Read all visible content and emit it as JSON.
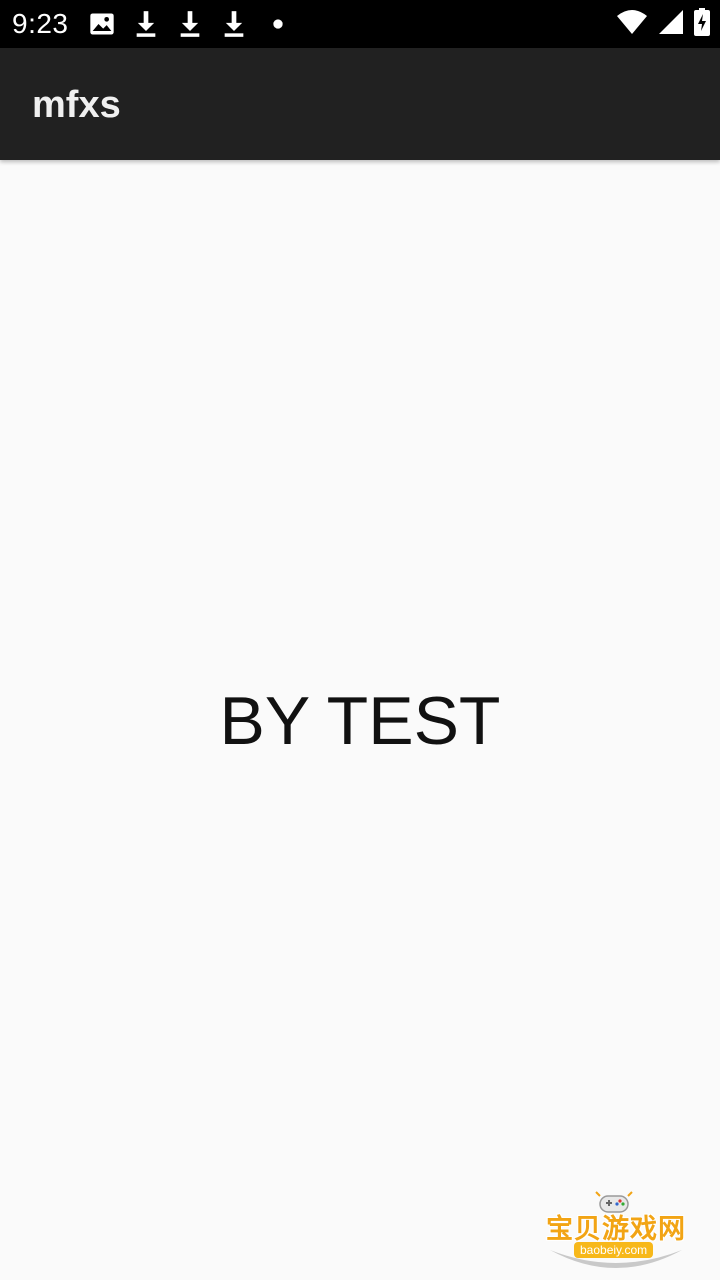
{
  "status_bar": {
    "time": "9:23",
    "icons_left": [
      "image-icon",
      "download-icon",
      "download-icon",
      "download-icon",
      "dot-icon"
    ],
    "icons_right": [
      "wifi-icon",
      "signal-icon",
      "battery-charging-icon"
    ]
  },
  "app_bar": {
    "title": "mfxs"
  },
  "content": {
    "text": "BY TEST"
  },
  "watermark": {
    "text": "宝贝游戏网",
    "url": "baobeiy.com"
  },
  "colors": {
    "status_bar_bg": "#000000",
    "app_bar_bg": "#212121",
    "page_bg": "#fafafa",
    "watermark_accent": "#f2a414"
  }
}
